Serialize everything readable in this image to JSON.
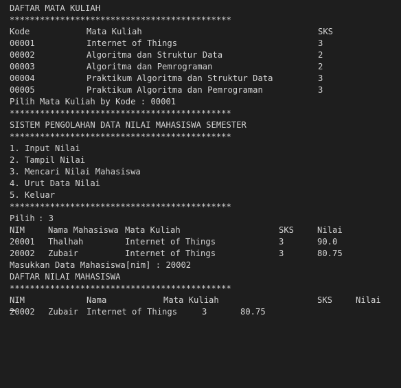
{
  "course_list": {
    "title": "DAFTAR MATA KULIAH",
    "separator": "********************************************",
    "headers": {
      "kode": "Kode",
      "mata_kuliah": "Mata Kuliah",
      "sks": "SKS"
    },
    "rows": [
      {
        "kode": "00001",
        "mata_kuliah": "Internet of Things",
        "sks": "3"
      },
      {
        "kode": "00002",
        "mata_kuliah": "Algoritma dan Struktur Data",
        "sks": "2"
      },
      {
        "kode": "00003",
        "mata_kuliah": "Algoritma dan Pemrograman",
        "sks": "2"
      },
      {
        "kode": "00004",
        "mata_kuliah": "Praktikum Algoritma dan Struktur Data",
        "sks": "3"
      },
      {
        "kode": "00005",
        "mata_kuliah": "Praktikum Algoritma dan Pemrograman",
        "sks": "3"
      }
    ],
    "pick_prompt": "Pilih Mata Kuliah by Kode : 00001"
  },
  "menu": {
    "title": "SISTEM PENGOLAHAN DATA NILAI MAHASISWA SEMESTER",
    "items": [
      "1. Input Nilai",
      "2. Tampil Nilai",
      "3. Mencari Nilai Mahasiswa",
      "4. Urut Data Nilai",
      "5. Keluar"
    ],
    "pick_label": "Pilih",
    "pick_value": ": 3"
  },
  "grades": {
    "headers": {
      "nim": "NIM",
      "nama": "Nama Mahasiswa",
      "mata_kuliah": "Mata Kuliah",
      "sks": "SKS",
      "nilai": "Nilai"
    },
    "rows": [
      {
        "nim": "20001",
        "nama": "Thalhah",
        "mata_kuliah": "Internet of Things",
        "sks": "3",
        "nilai": "90.0"
      },
      {
        "nim": "20002",
        "nama": "Zubair",
        "mata_kuliah": "Internet of Things",
        "sks": "3",
        "nilai": "80.75"
      }
    ]
  },
  "search": {
    "prompt": "Masukkan Data Mahasiswa[nim] : 20002",
    "title": "DAFTAR NILAI MAHASISWA",
    "headers": {
      "nim": "NIM",
      "nama": "Nama",
      "mata_kuliah": "Mata Kuliah",
      "sks": "SKS",
      "nilai": "Nilai"
    },
    "row": {
      "nim": "20002",
      "nama": "Zubair",
      "mata_kuliah": "Internet of Things",
      "sks": "3",
      "nilai": "80.75"
    }
  }
}
